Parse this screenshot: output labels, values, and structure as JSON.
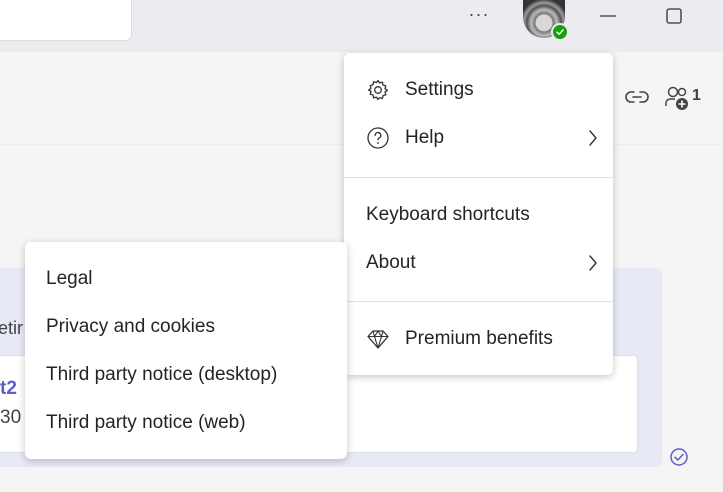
{
  "titlebar": {
    "more_label": "···"
  },
  "header": {
    "participants_count": "1"
  },
  "card": {
    "frag_meeting": "etir",
    "frag_title": "t2",
    "frag_time": "30 ."
  },
  "menu": {
    "items": [
      {
        "label": "Settings"
      },
      {
        "label": "Help"
      },
      {
        "label": "Keyboard shortcuts"
      },
      {
        "label": "About"
      },
      {
        "label": "Premium benefits"
      }
    ]
  },
  "submenu": {
    "items": [
      {
        "label": "Legal"
      },
      {
        "label": "Privacy and cookies"
      },
      {
        "label": "Third party notice (desktop)"
      },
      {
        "label": "Third party notice (web)"
      }
    ]
  },
  "colors": {
    "accent": "#5b5fc7",
    "presence": "#13a10e",
    "titlebar": "#ebebf0"
  }
}
